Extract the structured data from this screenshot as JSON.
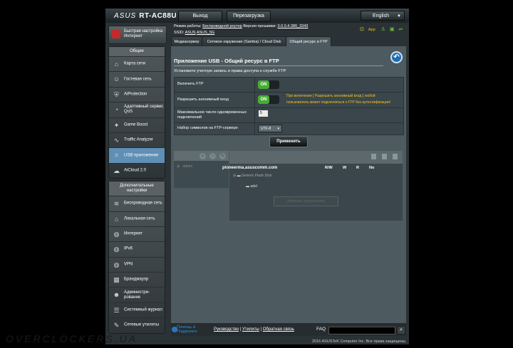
{
  "header": {
    "brand": "ASUS",
    "model": "RT-AC88U",
    "logout": "Выход",
    "reboot": "Перезагрузка",
    "language": "English"
  },
  "status": {
    "mode_label": "Режим работы:",
    "mode_value": "Беспроводной роутер",
    "fw_label": "Версия прошивки:",
    "fw_value": "3.0.0.4.380_3343",
    "ssid_label": "SSID:",
    "ssid_1": "ASUS",
    "ssid_2": "ASUS_5G",
    "app_label": "App"
  },
  "sidebar": {
    "qis": "Быстрая настройка Интернет",
    "general_title": "Общие",
    "general": [
      {
        "label": "Карта сети",
        "icon": "network-map-icon",
        "glyph": "⌂"
      },
      {
        "label": "Гостевая сеть",
        "icon": "guest-network-icon",
        "glyph": "☺"
      },
      {
        "label": "AiProtection",
        "icon": "aiprotection-icon",
        "glyph": "⛨"
      },
      {
        "label": "Адаптивный сервис QoS",
        "icon": "qos-icon",
        "glyph": "◔"
      },
      {
        "label": "Game Boost",
        "icon": "game-boost-icon",
        "glyph": "✦"
      },
      {
        "label": "Traffic Analyzer",
        "icon": "traffic-analyzer-icon",
        "glyph": "∿"
      },
      {
        "label": "USB приложение",
        "icon": "usb-app-icon",
        "glyph": "⌗"
      },
      {
        "label": "AiCloud 2.0",
        "icon": "aicloud-icon",
        "glyph": "☁"
      }
    ],
    "advanced_title": "Дополнительные настройки",
    "advanced": [
      {
        "label": "Беспроводная сеть",
        "icon": "wireless-icon",
        "glyph": "≋"
      },
      {
        "label": "Локальная сеть",
        "icon": "lan-icon",
        "glyph": "⌂"
      },
      {
        "label": "Интернет",
        "icon": "globe-icon",
        "glyph": "◍"
      },
      {
        "label": "IPv6",
        "icon": "ipv6-icon",
        "glyph": "◍"
      },
      {
        "label": "VPN",
        "icon": "vpn-icon",
        "glyph": "◍"
      },
      {
        "label": "Брандмауэр",
        "icon": "firewall-icon",
        "glyph": "▦"
      },
      {
        "label": "Администри-рование",
        "icon": "admin-icon",
        "glyph": "☻"
      },
      {
        "label": "Системный журнал",
        "icon": "syslog-icon",
        "glyph": "☰"
      },
      {
        "label": "Сетевые утилиты",
        "icon": "tools-icon",
        "glyph": "✎"
      }
    ]
  },
  "tabs": [
    "Медиасервер",
    "Сетевое окружение (Samba) / Cloud Disk",
    "Общий ресурс в FTP"
  ],
  "page": {
    "title": "Приложение USB - Общий ресурс в FTP",
    "description": "Установите учетную запись и права доступа к службе FTP"
  },
  "form": {
    "enable_ftp_label": "Включить FTP",
    "enable_ftp_value": "ON",
    "anon_label": "Разрешить анонимный вход",
    "anon_value": "ON",
    "anon_note_1": "При включении [ Разрешить анонимный вход ] любой",
    "anon_note_2": "пользователь может подключиться к FTP без аутентификации!",
    "max_conn_label_1": "Максимальное число одновременных",
    "max_conn_label_2": "подключений",
    "max_conn_value": "5",
    "charset_label": "Набор символов на FTP-сервере",
    "charset_value": "UTF-8",
    "apply": "Применить"
  },
  "share": {
    "user": "admin",
    "host": "pioneerma.asuscomm.com",
    "perm_cols": [
      "R/W",
      "W",
      "R",
      "No"
    ],
    "drive": "Generic Flash Disk",
    "folder": "adel",
    "button": "Изменить разрешения"
  },
  "footer": {
    "help_1": "Помощь &",
    "help_2": "Поддержка",
    "links": [
      "Руководство",
      "Утилиты",
      "Обратная связь"
    ],
    "faq": "FAQ",
    "copyright": "2016 ASUSTeK Computer Inc. Все права защищены."
  },
  "watermark": "OVERCLOCKERS.UA"
}
